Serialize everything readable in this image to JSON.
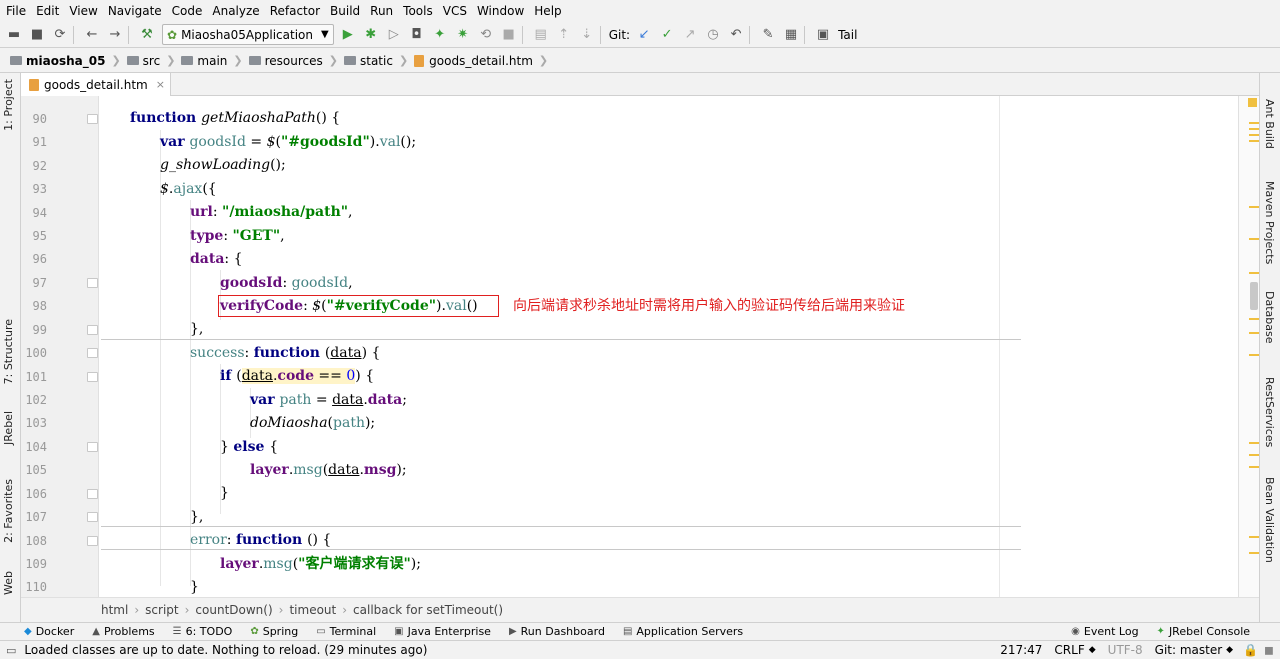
{
  "menu": [
    "File",
    "Edit",
    "View",
    "Navigate",
    "Code",
    "Analyze",
    "Refactor",
    "Build",
    "Run",
    "Tools",
    "VCS",
    "Window",
    "Help"
  ],
  "toolbar": {
    "run_config": "Miaosha05Application",
    "git_label": "Git:",
    "tail_label": "Tail"
  },
  "breadcrumbs": [
    "miaosha_05",
    "src",
    "main",
    "resources",
    "static",
    "goods_detail.htm"
  ],
  "left_tools": [
    "1: Project",
    "7: Structure",
    "JRebel",
    "2: Favorites",
    "Web"
  ],
  "right_tools": [
    "Ant Build",
    "Maven Projects",
    "Database",
    "RestServices",
    "Bean Validation"
  ],
  "tab": {
    "label": "goods_detail.htm",
    "close": "×"
  },
  "editor": {
    "line_numbers": [
      "90",
      "91",
      "92",
      "93",
      "94",
      "95",
      "96",
      "97",
      "98",
      "99",
      "100",
      "101",
      "102",
      "103",
      "104",
      "105",
      "106",
      "107",
      "108",
      "109",
      "110"
    ],
    "annotation": "向后端请求秒杀地址时需将用户输入的验证码传给后端用来验证",
    "code": {
      "l90": {
        "kw": "function ",
        "name1": "get",
        "name2": "M",
        "name3": "iaoshaPath",
        "rest": "() {"
      },
      "l91": {
        "kw": "var ",
        "v": "goodsId",
        "a": " = ",
        "fn": "$",
        "b": "(",
        "s": "\"#goodsId\"",
        "c": ").",
        "m": "val",
        "d": "();"
      },
      "l92": {
        "fn": "g_showLoading",
        "rest": "();"
      },
      "l93": {
        "fn": "$",
        "a": ".",
        "m": "ajax",
        "b": "({"
      },
      "l94": {
        "p": "url",
        "a": ": ",
        "s": "\"/miaosha/path\"",
        "b": ","
      },
      "l95": {
        "p": "type",
        "a": ": ",
        "s": "\"GET\"",
        "b": ","
      },
      "l96": {
        "p": "data",
        "a": ": {"
      },
      "l97": {
        "p": "goodsId",
        "a": ": ",
        "v": "goodsId",
        "b": ","
      },
      "l98": {
        "p": "verifyCode",
        "a": ": ",
        "fn": "$",
        "b": "(",
        "s": "\"#verifyCode\"",
        "c": ").",
        "m": "val",
        "d": "()"
      },
      "l99": {
        "a": "},"
      },
      "l100": {
        "v": "success",
        "a": ": ",
        "kw": "function ",
        "b": "(",
        "u": "data",
        "c": ") {"
      },
      "l101": {
        "kw": "if ",
        "a": "(",
        "u": "data",
        "b": ".",
        "p": "code",
        "c": " == ",
        "n": "0",
        "d": ") {"
      },
      "l102": {
        "kw": "var ",
        "v": "path",
        "a": " = ",
        "u": "data",
        "b": ".",
        "p": "data",
        "c": ";"
      },
      "l103": {
        "fn1": "do",
        "fn2": "M",
        "fn3": "iaosha",
        "a": "(",
        "v": "path",
        "b": ");"
      },
      "l104": {
        "a": "} ",
        "kw": "else ",
        "b": "{"
      },
      "l105": {
        "p1": "layer",
        "a": ".",
        "m": "msg",
        "b": "(",
        "u": "data",
        "c": ".",
        "p2": "msg",
        "d": ");"
      },
      "l106": {
        "a": "}"
      },
      "l107": {
        "a": "},"
      },
      "l108": {
        "v": "error",
        "a": ": ",
        "kw": "function ",
        "b": "() {"
      },
      "l109": {
        "p": "layer",
        "a": ".",
        "m": "msg",
        "b": "(",
        "s": "\"客户端请求有误\"",
        "c": ");"
      },
      "l110": {
        "a": "}"
      }
    }
  },
  "editor_breadcrumb": [
    "html",
    "script",
    "countDown()",
    "timeout",
    "callback for setTimeout()"
  ],
  "bottom_tools": [
    "Docker",
    "Problems",
    "6: TODO",
    "Spring",
    "Terminal",
    "Java Enterprise",
    "Run Dashboard",
    "Application Servers",
    "Event Log",
    "JRebel Console"
  ],
  "status": {
    "message": "Loaded classes are up to date. Nothing to reload. (29 minutes ago)",
    "position": "217:47",
    "line_sep": "CRLF",
    "encoding": "UTF-8",
    "git": "Git: master"
  }
}
